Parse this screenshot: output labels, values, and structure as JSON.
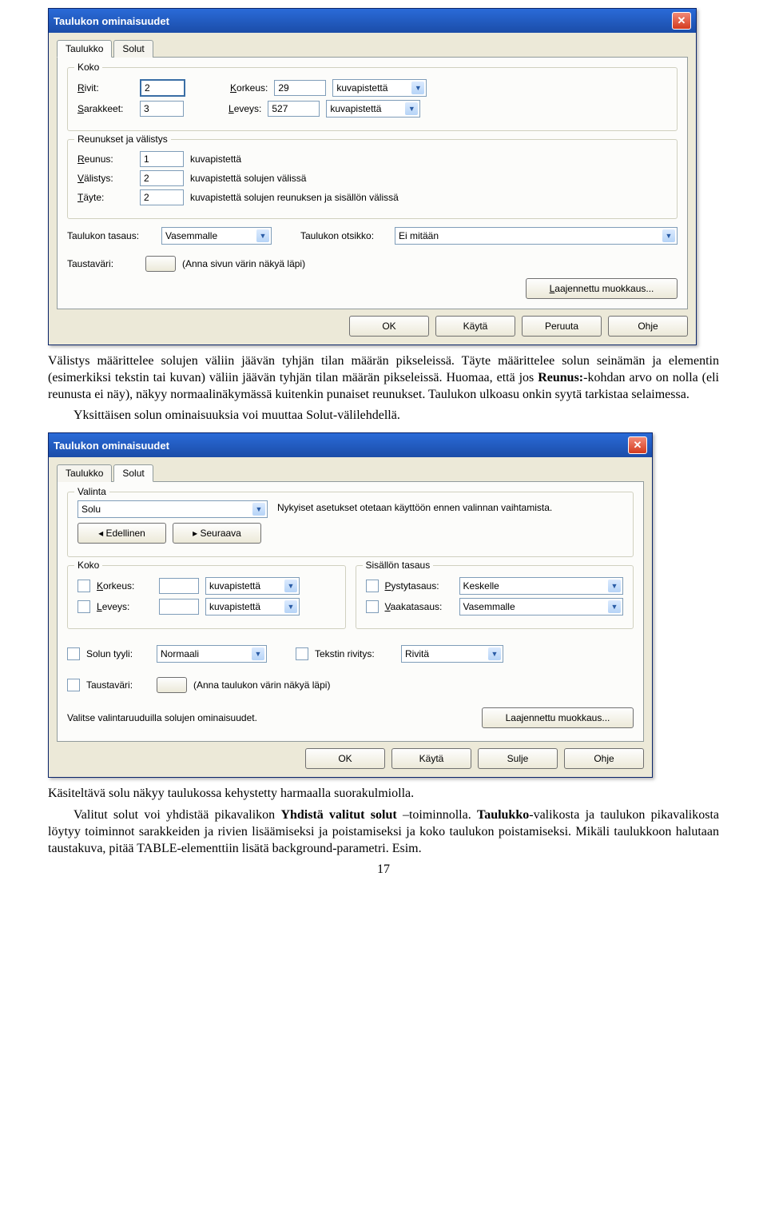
{
  "dialog1": {
    "title": "Taulukon ominaisuudet",
    "tabs": {
      "t1": "Taulukko",
      "t2": "Solut"
    },
    "koko": {
      "legend": "Koko",
      "rows_lbl": "Rivit:",
      "rows_val": "2",
      "height_lbl": "Korkeus:",
      "height_val": "29",
      "height_unit": "kuvapistettä",
      "cols_lbl": "Sarakkeet:",
      "cols_val": "3",
      "width_lbl": "Leveys:",
      "width_val": "527",
      "width_unit": "kuvapistettä"
    },
    "border": {
      "legend": "Reunukset ja välistys",
      "reunus_lbl": "Reunus:",
      "reunus_val": "1",
      "reunus_txt": "kuvapistettä",
      "valistys_lbl": "Välistys:",
      "valistys_val": "2",
      "valistys_txt": "kuvapistettä solujen välissä",
      "tayte_lbl": "Täyte:",
      "tayte_val": "2",
      "tayte_txt": "kuvapistettä solujen reunuksen ja sisällön välissä"
    },
    "align_lbl": "Taulukon tasaus:",
    "align_val": "Vasemmalle",
    "caption_lbl": "Taulukon otsikko:",
    "caption_val": "Ei mitään",
    "bg_lbl": "Taustaväri:",
    "bg_txt": "(Anna sivun värin näkyä läpi)",
    "adv_btn": "Laajennettu muokkaus...",
    "ok": "OK",
    "apply": "Käytä",
    "cancel": "Peruuta",
    "help": "Ohje"
  },
  "para1": {
    "p1a": "Välistys määrittelee solujen väliin jäävän tyhjän tilan määrän pikseleissä. Täyte määrittelee solun seinämän ja elementin (esimerkiksi tekstin tai kuvan) väliin jäävän tyhjän tilan määrän pikseleissä. Huomaa, että jos ",
    "p1b": "Reunus:",
    "p1c": "-kohdan arvo on nolla (eli reunusta ei näy), näkyy normaalinäkymässä kuitenkin punaiset reunukset. Taulukon ulkoasu onkin syytä tarkistaa selaimessa.",
    "p2": "Yksittäisen solun ominaisuuksia voi muuttaa Solut-välilehdellä."
  },
  "dialog2": {
    "title": "Taulukon ominaisuudet",
    "tabs": {
      "t1": "Taulukko",
      "t2": "Solut"
    },
    "valinta": {
      "legend": "Valinta",
      "sel": "Solu",
      "prev": "◂ Edellinen",
      "next": "▸ Seuraava",
      "note": "Nykyiset asetukset otetaan käyttöön ennen valinnan vaihtamista."
    },
    "koko": {
      "legend": "Koko",
      "height_lbl": "Korkeus:",
      "height_unit": "kuvapistettä",
      "width_lbl": "Leveys:",
      "width_unit": "kuvapistettä"
    },
    "sisalto": {
      "legend": "Sisällön tasaus",
      "v_lbl": "Pystytasaus:",
      "v_val": "Keskelle",
      "h_lbl": "Vaakatasaus:",
      "h_val": "Vasemmalle"
    },
    "style_lbl": "Solun tyyli:",
    "style_val": "Normaali",
    "wrap_lbl": "Tekstin rivitys:",
    "wrap_val": "Rivitä",
    "bg_lbl": "Taustaväri:",
    "bg_txt": "(Anna taulukon värin näkyä läpi)",
    "hint": "Valitse valintaruuduilla solujen ominaisuudet.",
    "adv_btn": "Laajennettu muokkaus...",
    "ok": "OK",
    "apply": "Käytä",
    "close": "Sulje",
    "help": "Ohje"
  },
  "para2": {
    "p1": "Käsiteltävä solu näkyy taulukossa kehystetty harmaalla suorakulmiolla.",
    "p2a": "Valitut solut voi yhdistää pikavalikon ",
    "p2b": "Yhdistä valitut solut",
    "p2c": " –toiminnolla. ",
    "p2d": "Taulukko",
    "p2e": "-valikosta ja taulukon pikavalikosta löytyy toiminnot sarakkeiden ja rivien lisäämiseksi ja poistamiseksi ja koko taulukon poistamiseksi. Mikäli taulukkoon halutaan taustakuva, pitää TABLE-elementtiin lisätä background-parametri. Esim."
  },
  "page": "17"
}
